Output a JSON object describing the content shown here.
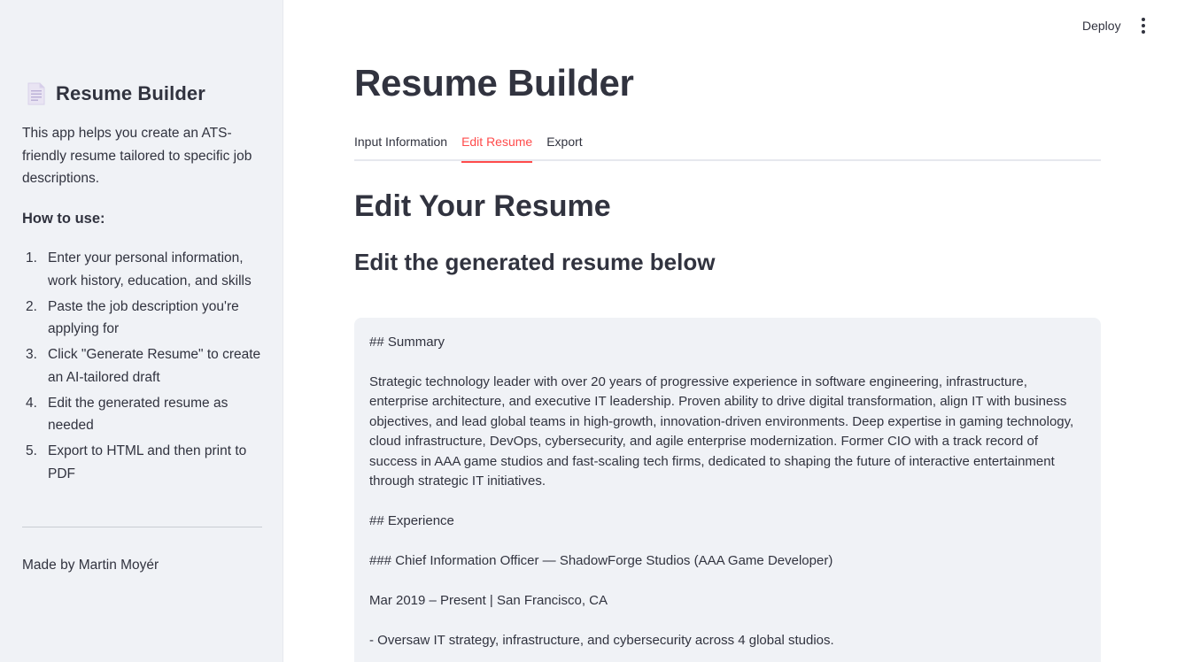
{
  "sidebar": {
    "title": "Resume Builder",
    "description": "This app helps you create an ATS-friendly resume tailored to specific job descriptions.",
    "how_to_title": "How to use:",
    "steps": [
      {
        "num": "1.",
        "text": "Enter your personal information, work history, education, and skills"
      },
      {
        "num": "2.",
        "text": "Paste the job description you're applying for"
      },
      {
        "num": "3.",
        "text": "Click \"Generate Resume\" to create an AI-tailored draft"
      },
      {
        "num": "4.",
        "text": "Edit the generated resume as needed"
      },
      {
        "num": "5.",
        "text": "Export to HTML and then print to PDF"
      }
    ],
    "footer": "Made by Martin Moyér",
    "icon": "document-icon"
  },
  "header": {
    "deploy_label": "Deploy",
    "menu_icon": "kebab-menu-icon"
  },
  "main": {
    "title": "Resume Builder",
    "tabs": [
      {
        "label": "Input Information",
        "active": false
      },
      {
        "label": "Edit Resume",
        "active": true
      },
      {
        "label": "Export",
        "active": false
      }
    ],
    "heading": "Edit Your Resume",
    "subheading": "Edit the generated resume below",
    "editor_lines": [
      "## Summary",
      "Strategic technology leader with over 20 years of progressive experience in software engineering, infrastructure, enterprise architecture, and executive IT leadership. Proven ability to drive digital transformation, align IT with business objectives, and lead global teams in high-growth, innovation-driven environments. Deep expertise in gaming technology, cloud infrastructure, DevOps, cybersecurity, and agile enterprise modernization. Former CIO with a track record of success in AAA game studios and fast-scaling tech firms, dedicated to shaping the future of interactive entertainment through strategic IT initiatives.",
      "## Experience",
      "### Chief Information Officer — ShadowForge Studios (AAA Game Developer)",
      "Mar 2019 – Present | San Francisco, CA",
      "- Oversaw IT strategy, infrastructure, and cybersecurity across 4 global studios."
    ]
  },
  "colors": {
    "accent": "#ff4b4b",
    "sidebar_bg": "#f0f2f6",
    "text": "#31333f"
  }
}
